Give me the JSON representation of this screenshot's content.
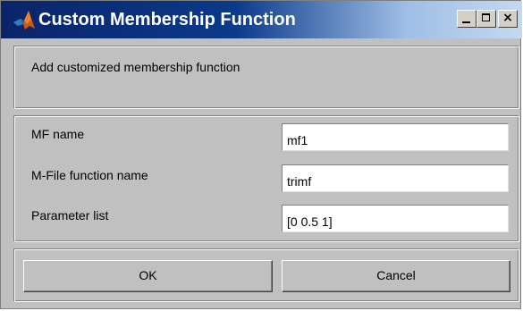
{
  "window": {
    "title": "Custom Membership Function",
    "icon": "matlab-logo-icon",
    "controls": {
      "minimize": "minimize-icon",
      "maximize": "maximize-icon",
      "close": "×"
    }
  },
  "header": {
    "text": "Add customized membership function"
  },
  "fields": [
    {
      "label": "MF name",
      "value": "mf1"
    },
    {
      "label": "M-File function name",
      "value": "trimf"
    },
    {
      "label": "Parameter list",
      "value": "[0 0.5 1]"
    }
  ],
  "buttons": {
    "ok": "OK",
    "cancel": "Cancel"
  }
}
